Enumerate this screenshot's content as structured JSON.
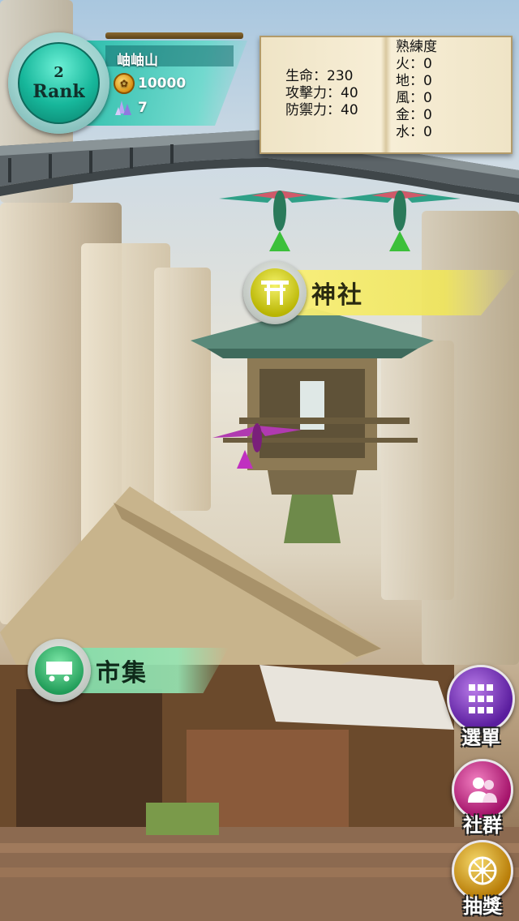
{
  "player": {
    "rank_number": "2",
    "rank_label": "Rank",
    "name": "岫岫山",
    "coins": "10000",
    "gems": "7"
  },
  "stats": {
    "hp": "生命：230",
    "attack": "攻擊力：40",
    "defense": "防禦力：40",
    "proficiency_title": "熟練度",
    "fire": "火：0",
    "earth": "地：0",
    "wind": "風：0",
    "metal": "金：0",
    "water": "水：0"
  },
  "locations": {
    "shrine": "神社",
    "market": "市集"
  },
  "side_menu": {
    "menu": "選單",
    "social": "社群",
    "draw": "抽獎"
  },
  "icons": {
    "rank": "rank-orb-icon",
    "coin": "coin-icon",
    "gem": "gem-icon",
    "shrine": "torii-gate-icon",
    "market": "cart-icon",
    "menu": "grid-icon",
    "social": "people-icon",
    "draw": "wheel-icon"
  },
  "colors": {
    "teal_accent": "#1fbfa0",
    "shrine_yellow": "#f0e65a",
    "market_green": "#8fe0b4",
    "menu_purple": "#6a2bb0",
    "social_pink": "#c2207f",
    "draw_gold": "#d9a520"
  }
}
